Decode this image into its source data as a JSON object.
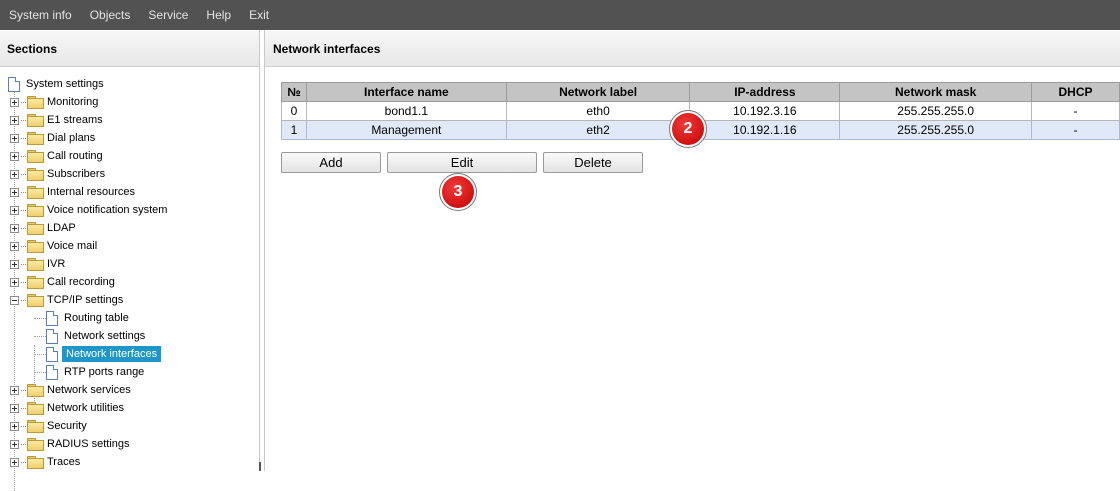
{
  "menu": [
    "System info",
    "Objects",
    "Service",
    "Help",
    "Exit"
  ],
  "sections": {
    "title": "Sections",
    "root": "System settings",
    "items": [
      {
        "label": "Monitoring",
        "expanded": false
      },
      {
        "label": "E1 streams",
        "expanded": false
      },
      {
        "label": "Dial plans",
        "expanded": false
      },
      {
        "label": "Call routing",
        "expanded": false
      },
      {
        "label": "Subscribers",
        "expanded": false
      },
      {
        "label": "Internal resources",
        "expanded": false
      },
      {
        "label": "Voice notification system",
        "expanded": false
      },
      {
        "label": "LDAP",
        "expanded": false
      },
      {
        "label": "Voice mail",
        "expanded": false
      },
      {
        "label": "IVR",
        "expanded": false
      },
      {
        "label": "Call recording",
        "expanded": false
      },
      {
        "label": "TCP/IP settings",
        "expanded": true
      },
      {
        "label": "Network services",
        "expanded": false
      },
      {
        "label": "Network utilities",
        "expanded": false
      },
      {
        "label": "Security",
        "expanded": false
      },
      {
        "label": "RADIUS settings",
        "expanded": false
      },
      {
        "label": "Traces",
        "expanded": false
      }
    ],
    "tcpip_children": [
      "Routing table",
      "Network settings",
      "Network interfaces",
      "RTP ports range"
    ],
    "selected": "Network interfaces"
  },
  "main": {
    "title": "Network interfaces",
    "columns": [
      "№",
      "Interface name",
      "Network label",
      "IP-address",
      "Network mask",
      "DHCP"
    ],
    "rows": [
      [
        "0",
        "bond1.1",
        "eth0",
        "10.192.3.16",
        "255.255.255.0",
        "-"
      ],
      [
        "1",
        "Management",
        "eth2",
        "10.192.1.16",
        "255.255.255.0",
        "-"
      ]
    ],
    "selected_row": 1,
    "buttons": {
      "add": "Add",
      "edit": "Edit",
      "delete": "Delete"
    },
    "markers": [
      "2",
      "3"
    ]
  }
}
